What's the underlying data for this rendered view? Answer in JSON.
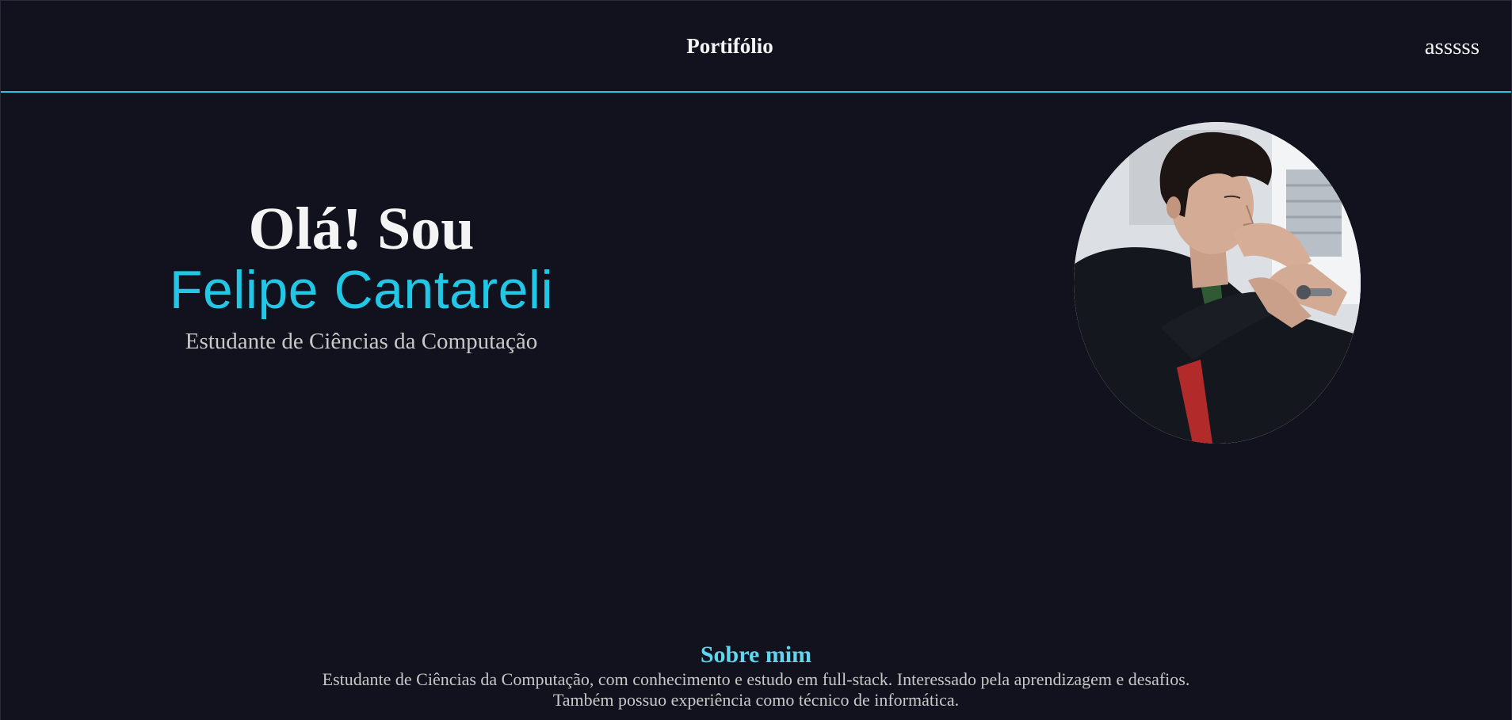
{
  "header": {
    "brand": "Portifólio",
    "nav_link": "asssss",
    "accent_color": "#22c7e6"
  },
  "hero": {
    "greeting": "Olá! Sou",
    "name": "Felipe Cantareli",
    "role": "Estudante de Ciências da Computação",
    "photo_alt": "profile photo"
  },
  "about": {
    "title": "Sobre mim",
    "text": "Estudante de Ciências da Computação, com conhecimento e estudo em full-stack. Interessado pela aprendizagem e desafios. Também possuo experiência como técnico de informática."
  },
  "colors": {
    "background": "#12121e",
    "accent": "#22c7e6",
    "heading": "#f4f4f4",
    "body_text": "#c8c8c8",
    "section_title": "#5fd6ee"
  }
}
